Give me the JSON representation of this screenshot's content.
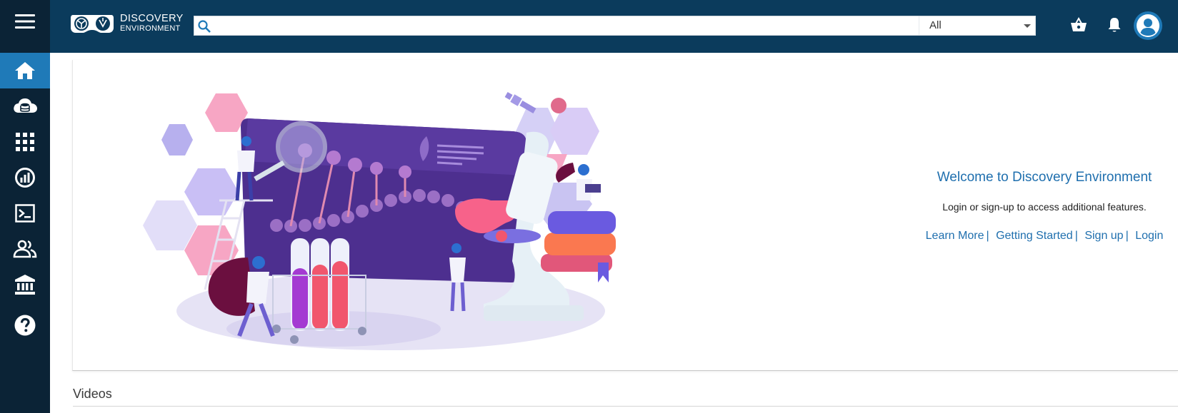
{
  "app": {
    "brand_line1": "DISCOVERY",
    "brand_line2": "ENVIRONMENT"
  },
  "colors": {
    "sidebar_bg": "#0b2336",
    "topbar_bg": "#0b3b5c",
    "accent": "#1f7ab8",
    "link": "#1f6fae"
  },
  "search": {
    "placeholder": "",
    "value": "",
    "filter_value": "All"
  },
  "sidebar": {
    "items": [
      {
        "name": "home",
        "icon": "home-icon",
        "active": true
      },
      {
        "name": "data",
        "icon": "cloud-database-icon",
        "active": false
      },
      {
        "name": "apps",
        "icon": "grid-icon",
        "active": false
      },
      {
        "name": "analyses",
        "icon": "analytics-icon",
        "active": false
      },
      {
        "name": "vice",
        "icon": "terminal-icon",
        "active": false
      },
      {
        "name": "teams",
        "icon": "people-icon",
        "active": false
      },
      {
        "name": "collections",
        "icon": "institution-icon",
        "active": false
      },
      {
        "name": "help",
        "icon": "help-icon",
        "active": false
      }
    ]
  },
  "toolbar_icons": [
    "basket-icon",
    "bell-icon",
    "account-icon"
  ],
  "welcome": {
    "title": "Welcome to Discovery Environment",
    "subtitle": "Login or sign-up to access additional features.",
    "links": [
      {
        "label": "Learn More"
      },
      {
        "label": "Getting Started"
      },
      {
        "label": "Sign up"
      },
      {
        "label": "Login"
      }
    ]
  },
  "sections": {
    "videos_title": "Videos"
  }
}
